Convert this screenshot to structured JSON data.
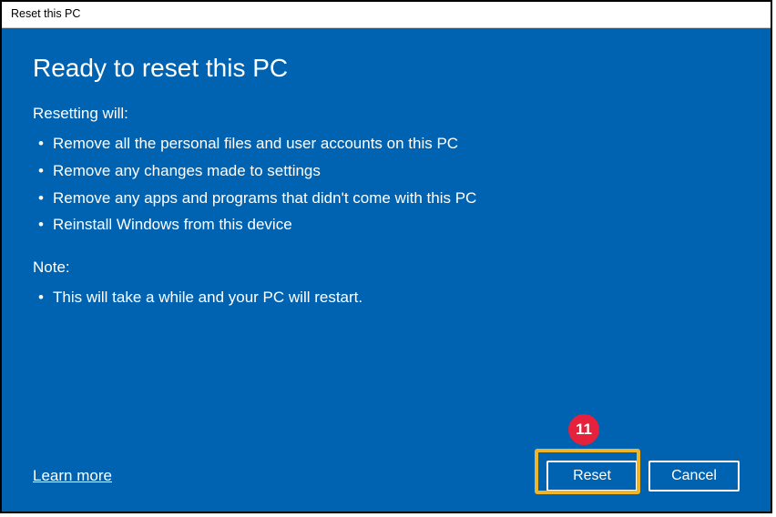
{
  "titlebar": "Reset this PC",
  "heading": "Ready to reset this PC",
  "resetting_label": "Resetting will:",
  "resetting_items": [
    "Remove all the personal files and user accounts on this PC",
    "Remove any changes made to settings",
    "Remove any apps and programs that didn't come with this PC",
    "Reinstall Windows from this device"
  ],
  "note_label": "Note:",
  "note_items": [
    "This will take a while and your PC will restart."
  ],
  "learn_more": "Learn more",
  "buttons": {
    "reset": "Reset",
    "cancel": "Cancel"
  },
  "callout_number": "11"
}
